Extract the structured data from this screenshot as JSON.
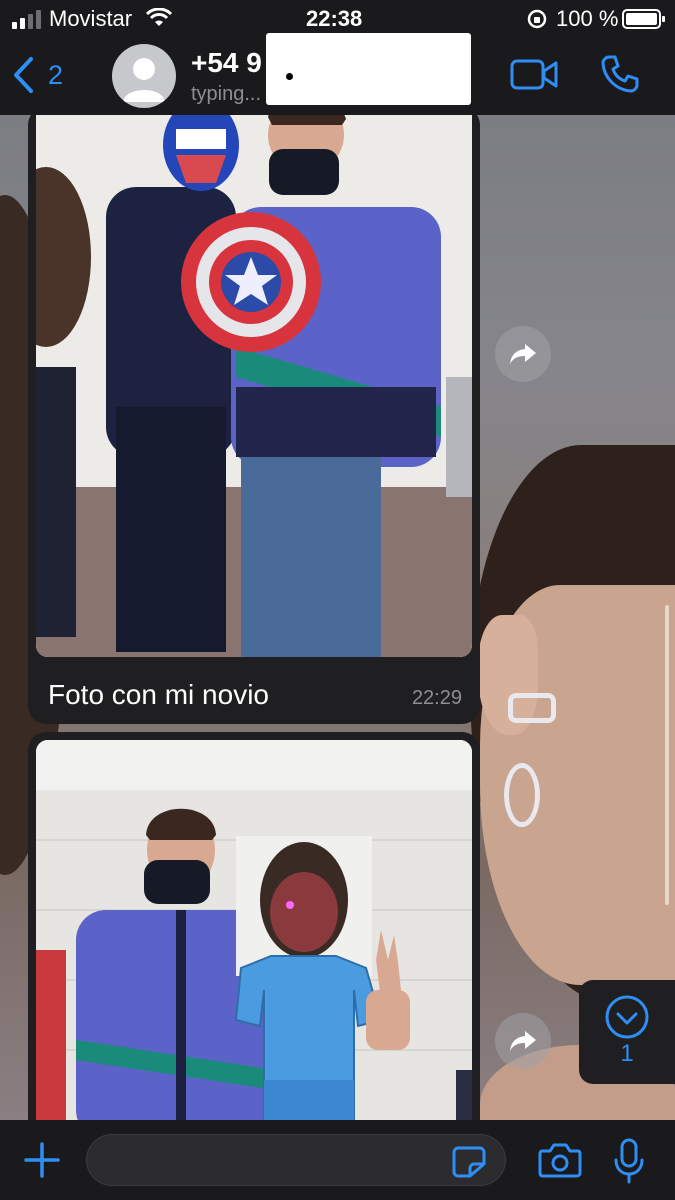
{
  "status_bar": {
    "carrier": "Movistar",
    "time": "22:38",
    "battery": "100 %"
  },
  "header": {
    "back_count": "2",
    "contact_name": "+54 9",
    "contact_status": "typing..."
  },
  "messages": [
    {
      "type": "image",
      "caption": "Foto con mi novio",
      "time": "22:29"
    },
    {
      "type": "image",
      "caption": "",
      "time": ""
    }
  ],
  "scroll_down": {
    "unread_count": "1"
  },
  "composer": {
    "placeholder": "",
    "value": ""
  },
  "colors": {
    "accent": "#2f8ef5",
    "bar_bg": "#1a1a1c",
    "bubble_bg": "#1f1f21",
    "meta_text": "#8e8e93"
  },
  "icons": {
    "back": "chevron-left-icon",
    "video": "video-camera-icon",
    "call": "phone-icon",
    "forward": "forward-arrow-icon",
    "scroll_down": "chevron-down-circle-icon",
    "plus": "plus-icon",
    "sticker": "sticker-icon",
    "camera": "camera-icon",
    "mic": "microphone-icon"
  }
}
